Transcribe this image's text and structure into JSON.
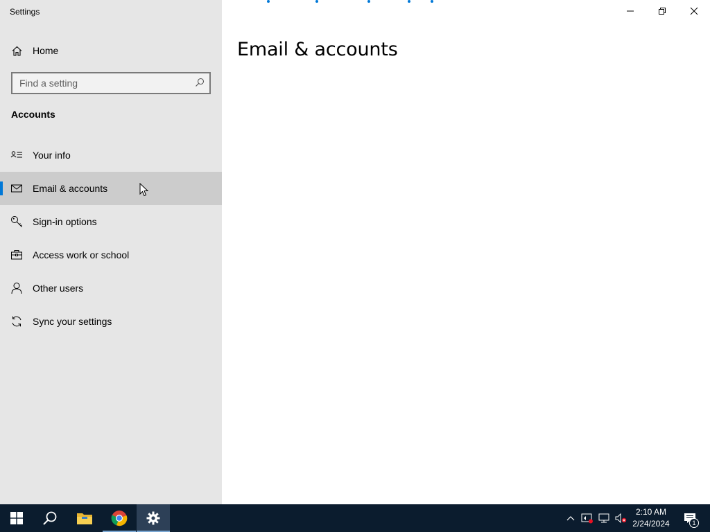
{
  "window": {
    "app_title": "Settings",
    "minimize_icon": "minimize-icon",
    "restore_icon": "restore-icon",
    "close_icon": "close-icon"
  },
  "sidebar": {
    "home_label": "Home",
    "home_icon": "home-icon",
    "search_placeholder": "Find a setting",
    "search_value": "",
    "section_title": "Accounts",
    "items": [
      {
        "label": "Your info",
        "icon": "contact-card-icon",
        "active": false
      },
      {
        "label": "Email & accounts",
        "icon": "mail-icon",
        "active": true
      },
      {
        "label": "Sign-in options",
        "icon": "key-icon",
        "active": false
      },
      {
        "label": "Access work or school",
        "icon": "briefcase-icon",
        "active": false
      },
      {
        "label": "Other users",
        "icon": "person-icon",
        "active": false
      },
      {
        "label": "Sync your settings",
        "icon": "sync-icon",
        "active": false
      }
    ]
  },
  "main": {
    "page_title": "Email & accounts"
  },
  "taskbar": {
    "apps": [
      {
        "name": "Start",
        "icon": "windows-logo-icon"
      },
      {
        "name": "Search",
        "icon": "search-icon"
      },
      {
        "name": "File Explorer",
        "icon": "folder-icon"
      },
      {
        "name": "Google Chrome",
        "icon": "chrome-icon"
      },
      {
        "name": "Settings",
        "icon": "gear-icon",
        "active": true
      }
    ],
    "tray_icons": [
      "chevron-up-icon",
      "security-alert-icon",
      "network-icon",
      "volume-muted-icon"
    ],
    "time": "2:10 AM",
    "date": "2/24/2024",
    "notification_count": "1"
  },
  "colors": {
    "accent": "#0078d7",
    "sidebar_bg": "#e6e6e6",
    "active_item_bg": "#cccccc",
    "taskbar_bg": "#0b1c2e"
  }
}
